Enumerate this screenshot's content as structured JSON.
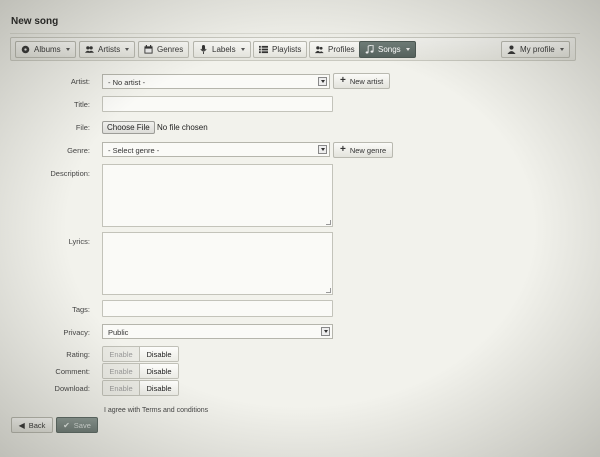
{
  "page": {
    "title": "New song"
  },
  "nav": {
    "albums": "Albums",
    "artists": "Artists",
    "genres": "Genres",
    "labels": "Labels",
    "playlists": "Playlists",
    "profiles": "Profiles",
    "songs": "Songs",
    "my_profile": "My profile",
    "active": "songs"
  },
  "form": {
    "artist": {
      "label": "Artist:",
      "value": "- No artist -",
      "add_button": "New artist"
    },
    "title": {
      "label": "Title:",
      "value": ""
    },
    "file": {
      "label": "File:",
      "button": "Choose File",
      "status": "No file chosen"
    },
    "genre": {
      "label": "Genre:",
      "value": "- Select genre -",
      "add_button": "New genre"
    },
    "description": {
      "label": "Description:",
      "value": ""
    },
    "lyrics": {
      "label": "Lyrics:",
      "value": ""
    },
    "tags": {
      "label": "Tags:",
      "value": ""
    },
    "privacy": {
      "label": "Privacy:",
      "value": "Public"
    },
    "rating": {
      "label": "Rating:",
      "enable": "Enable",
      "disable": "Disable",
      "selected": "Disable"
    },
    "comment": {
      "label": "Comment:",
      "enable": "Enable",
      "disable": "Disable",
      "selected": "Disable"
    },
    "download": {
      "label": "Download:",
      "enable": "Enable",
      "disable": "Disable",
      "selected": "Disable"
    },
    "terms": {
      "prefix": "I agree with",
      "link": "Terms and conditions"
    }
  },
  "actions": {
    "back": "Back",
    "save": "Save"
  },
  "colors": {
    "active_tab": "#5f6c67",
    "save_button": "#7a8782",
    "background": "#f2f2ec"
  },
  "icons": {
    "albums": "disc-icon",
    "artists": "users-icon",
    "genres": "calendar-icon",
    "labels": "microphone-icon",
    "playlists": "list-icon",
    "profiles": "people-icon",
    "songs": "music-note-icon",
    "my_profile": "user-icon",
    "back": "arrow-left-icon",
    "save": "check-icon"
  }
}
